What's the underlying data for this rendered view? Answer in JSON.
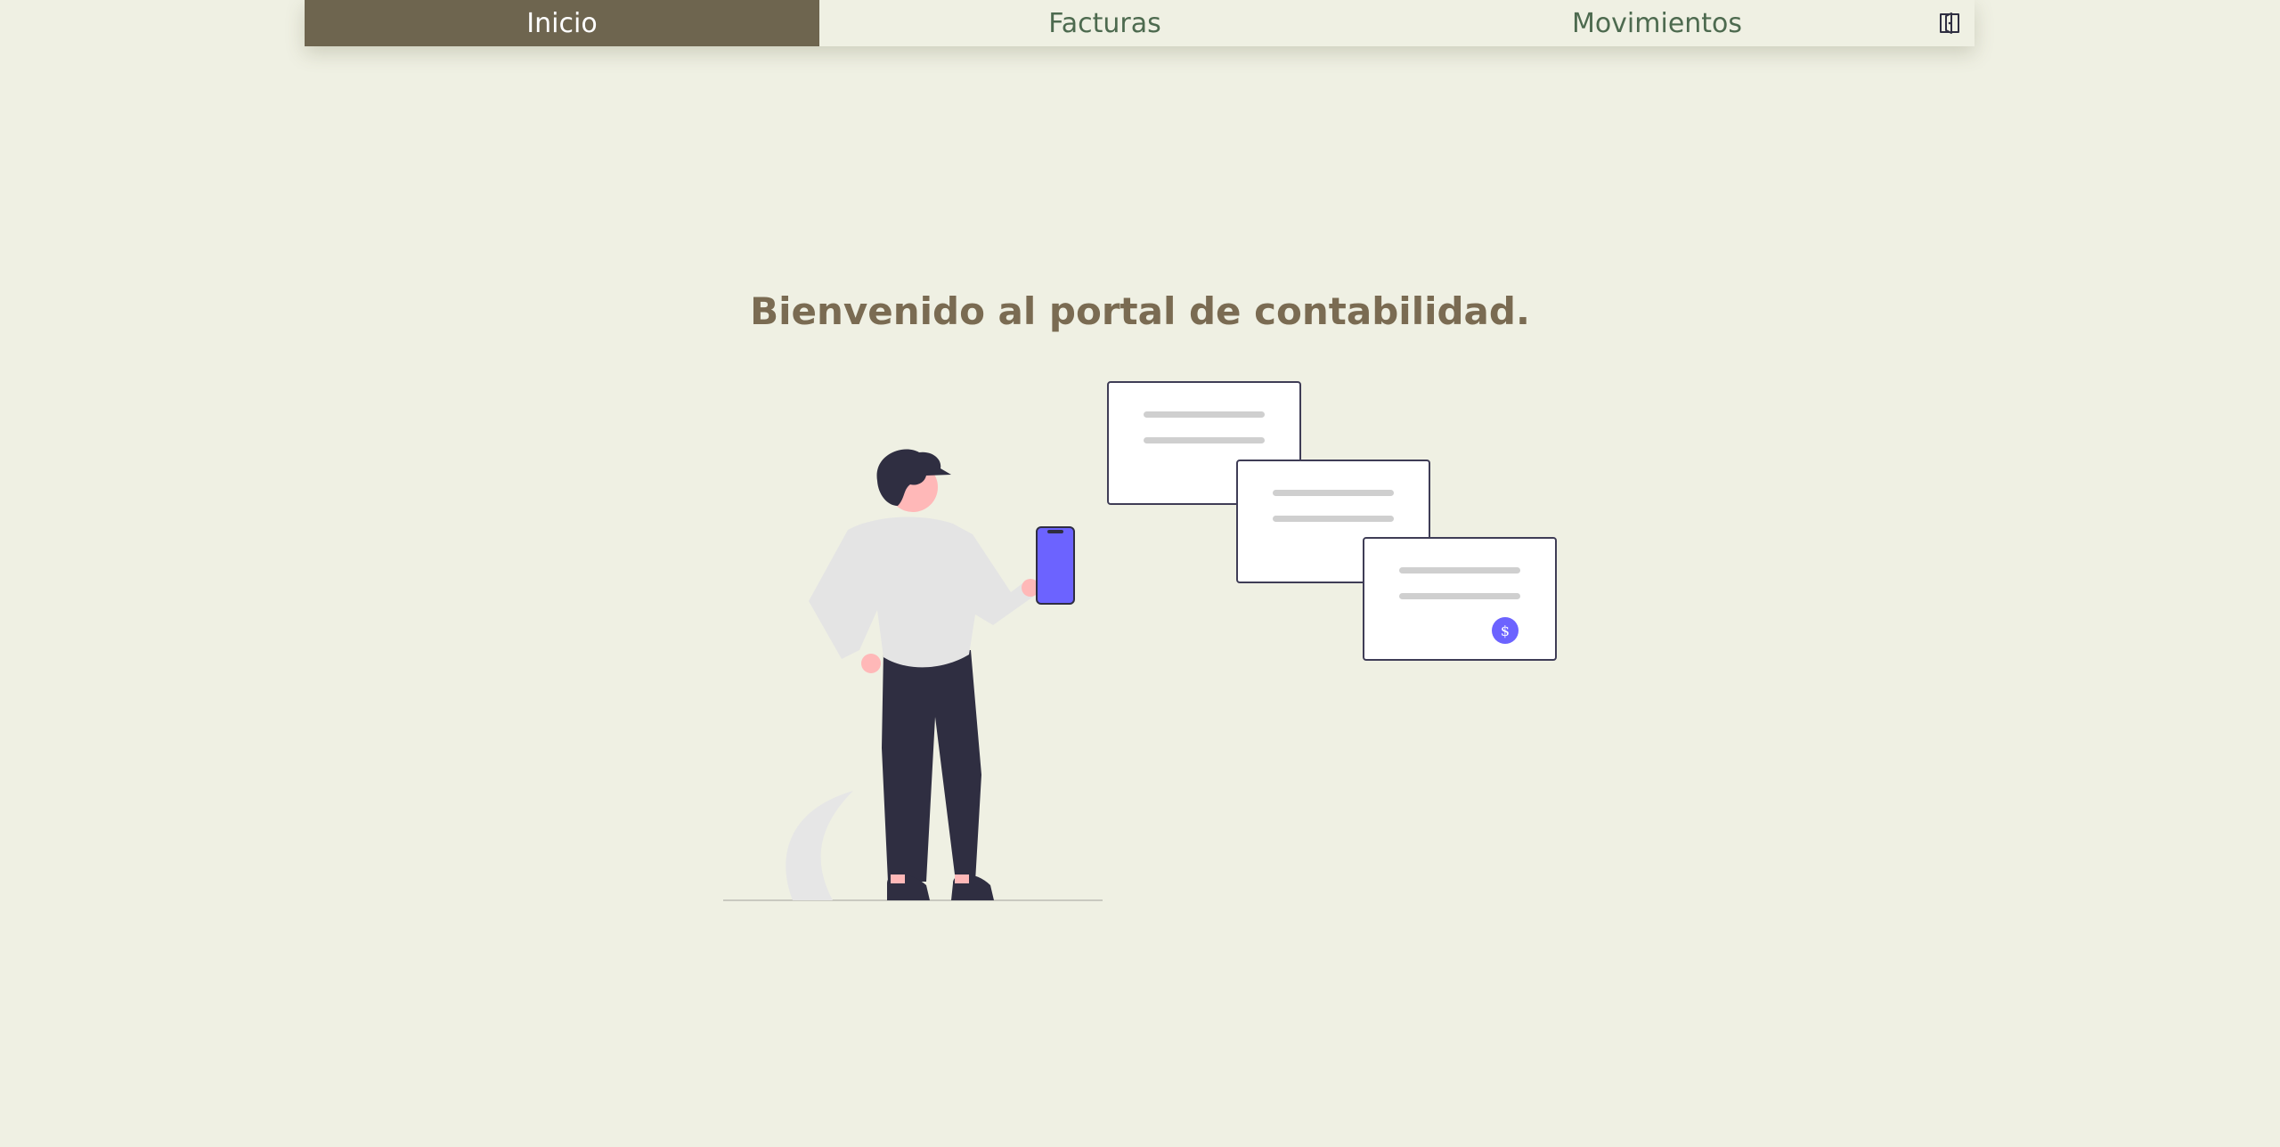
{
  "nav": {
    "items": [
      {
        "label": "Inicio",
        "active": true
      },
      {
        "label": "Facturas",
        "active": false
      },
      {
        "label": "Movimientos",
        "active": false
      }
    ],
    "logout_icon": "logout-door-icon"
  },
  "main": {
    "welcome_title": "Bienvenido al portal de contabilidad."
  },
  "illustration": {
    "icon": "person-with-phone-and-invoices",
    "coin_symbol": "$"
  },
  "colors": {
    "background": "#eff0e3",
    "nav_active": "#6e654f",
    "nav_text": "#4d6a4f",
    "title": "#7a6b52",
    "accent": "#6c63ff"
  }
}
